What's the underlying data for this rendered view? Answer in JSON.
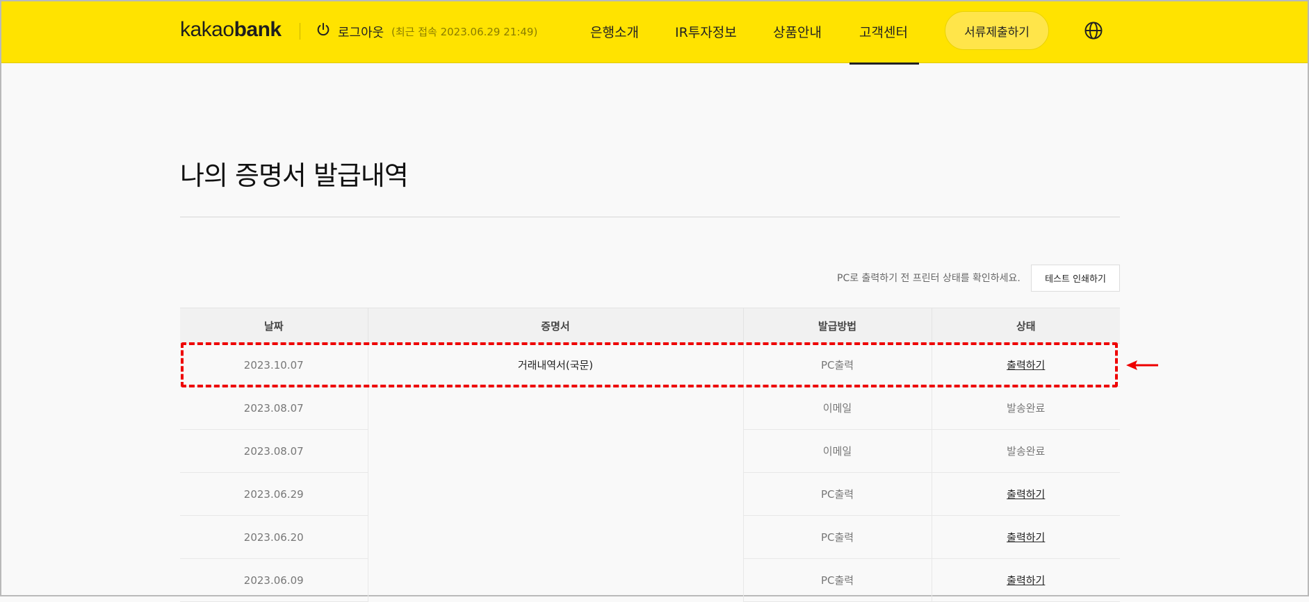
{
  "header": {
    "logo_light": "kakao",
    "logo_bold": "bank",
    "logout_label": "로그아웃",
    "last_login": "(최근 접속 2023.06.29 21:49)",
    "nav": [
      "은행소개",
      "IR투자정보",
      "상품안내",
      "고객센터"
    ],
    "active_nav": "고객센터",
    "submit_button": "서류제출하기",
    "icons": {
      "logout": "power-icon",
      "language": "globe-icon"
    },
    "colors": {
      "brand": "#ffe300"
    }
  },
  "page": {
    "title": "나의 증명서 발급내역",
    "printer_note": "PC로 출력하기 전 프린터 상태를 확인하세요.",
    "test_print_button": "테스트 인쇄하기"
  },
  "table": {
    "headers": [
      "날짜",
      "증명서",
      "발급방법",
      "상태"
    ],
    "rows": [
      {
        "date": "2023.10.07",
        "document": "거래내역서(국문)",
        "method": "PC출력",
        "status": "출력하기",
        "status_link": true
      },
      {
        "date": "2023.08.07",
        "document": "",
        "method": "이메일",
        "status": "발송완료",
        "status_link": false
      },
      {
        "date": "2023.08.07",
        "document": "",
        "method": "이메일",
        "status": "발송완료",
        "status_link": false
      },
      {
        "date": "2023.06.29",
        "document": "",
        "method": "PC출력",
        "status": "출력하기",
        "status_link": true
      },
      {
        "date": "2023.06.20",
        "document": "",
        "method": "PC출력",
        "status": "출력하기",
        "status_link": true
      },
      {
        "date": "2023.06.09",
        "document": "",
        "method": "PC출력",
        "status": "출력하기",
        "status_link": true
      }
    ]
  },
  "annotation": {
    "highlight_color": "#ee0000",
    "highlighted_row": 0
  }
}
